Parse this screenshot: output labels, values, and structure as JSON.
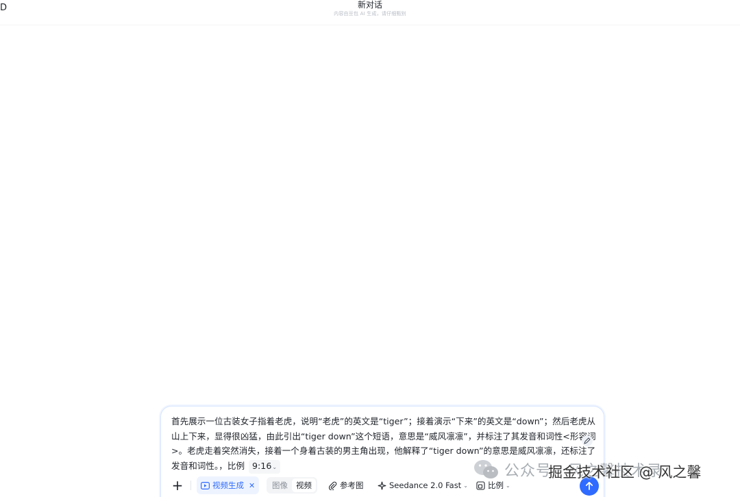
{
  "window": {
    "corner_glyph": "D"
  },
  "header": {
    "title": "新对话",
    "subtitle": "内容由豆包 AI 生成，请仔细甄别"
  },
  "composer": {
    "prompt_text": "首先展示一位古装女子指着老虎，说明“老虎”的英文是“tiger”；接着演示“下来”的英文是“down”；然后老虎从山上下来，显得很凶猛，由此引出“tiger down”这个短语，意思是“威风凛凛”，并标注了其发音和词性<形容词>。老虎走着突然消失，接着一个身着古装的男主角出现，他解释了“tiger down”的意思是威风凛凛，还标注了发音和词性。，比例",
    "ratio_value": "9:16",
    "toolbar": {
      "mode_chip_label": "视频生成",
      "segment_image": "图像",
      "segment_video": "视频",
      "reference_label": "参考图",
      "model_label": "Seedance 2.0 Fast",
      "ratio_label": "比例"
    },
    "icons": {
      "plus": "plus-icon",
      "video": "video-play-icon",
      "close": "close-icon",
      "attach": "paperclip-icon",
      "model": "sparkle-icon",
      "ratio": "aspect-ratio-icon",
      "send": "arrow-up-icon",
      "edit": "pen-icon"
    },
    "colors": {
      "accent": "#2f6bff",
      "border": "#d7e5ff"
    }
  },
  "watermark": {
    "account_label": "公众号 · 风之馨技术录",
    "site_label": "掘金技术社区 @ 风之馨",
    "icon": "wechat-icon"
  }
}
